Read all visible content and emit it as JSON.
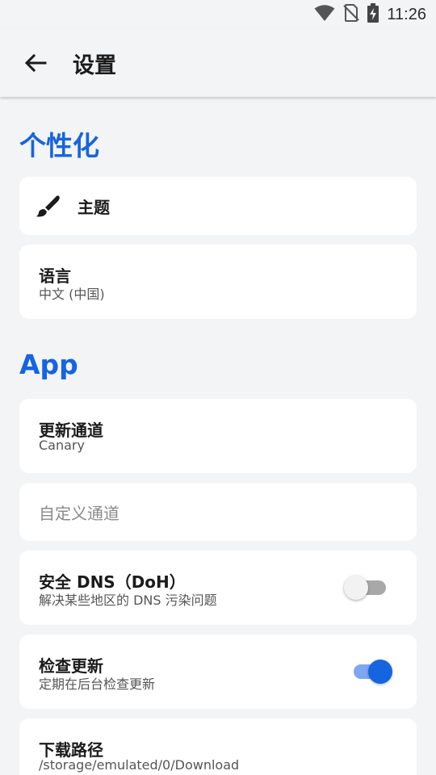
{
  "status_bar": {
    "time": "11:26",
    "icons": [
      "wifi-icon",
      "no-sim-icon",
      "battery-charging-icon"
    ]
  },
  "app_bar": {
    "back_icon": "arrow-back-icon",
    "title": "设置"
  },
  "sections": {
    "personalization": {
      "title": "个性化",
      "theme": {
        "icon": "brush-icon",
        "label": "主题"
      },
      "language": {
        "label": "语言",
        "value": "中文 (中国)"
      }
    },
    "app": {
      "title": "App",
      "update_channel": {
        "label": "更新通道",
        "value": "Canary"
      },
      "custom_channel": {
        "label": "自定义通道",
        "enabled": false
      },
      "secure_dns": {
        "label": "安全 DNS（DoH）",
        "description": "解决某些地区的 DNS 污染问题",
        "checked": false
      },
      "check_updates": {
        "label": "检查更新",
        "description": "定期在后台检查更新",
        "checked": true
      },
      "download_path": {
        "label": "下载路径",
        "value": "/storage/emulated/0/Download"
      }
    }
  },
  "colors": {
    "accent": "#1565e0",
    "background": "#f3f4f6",
    "card": "#ffffff"
  }
}
